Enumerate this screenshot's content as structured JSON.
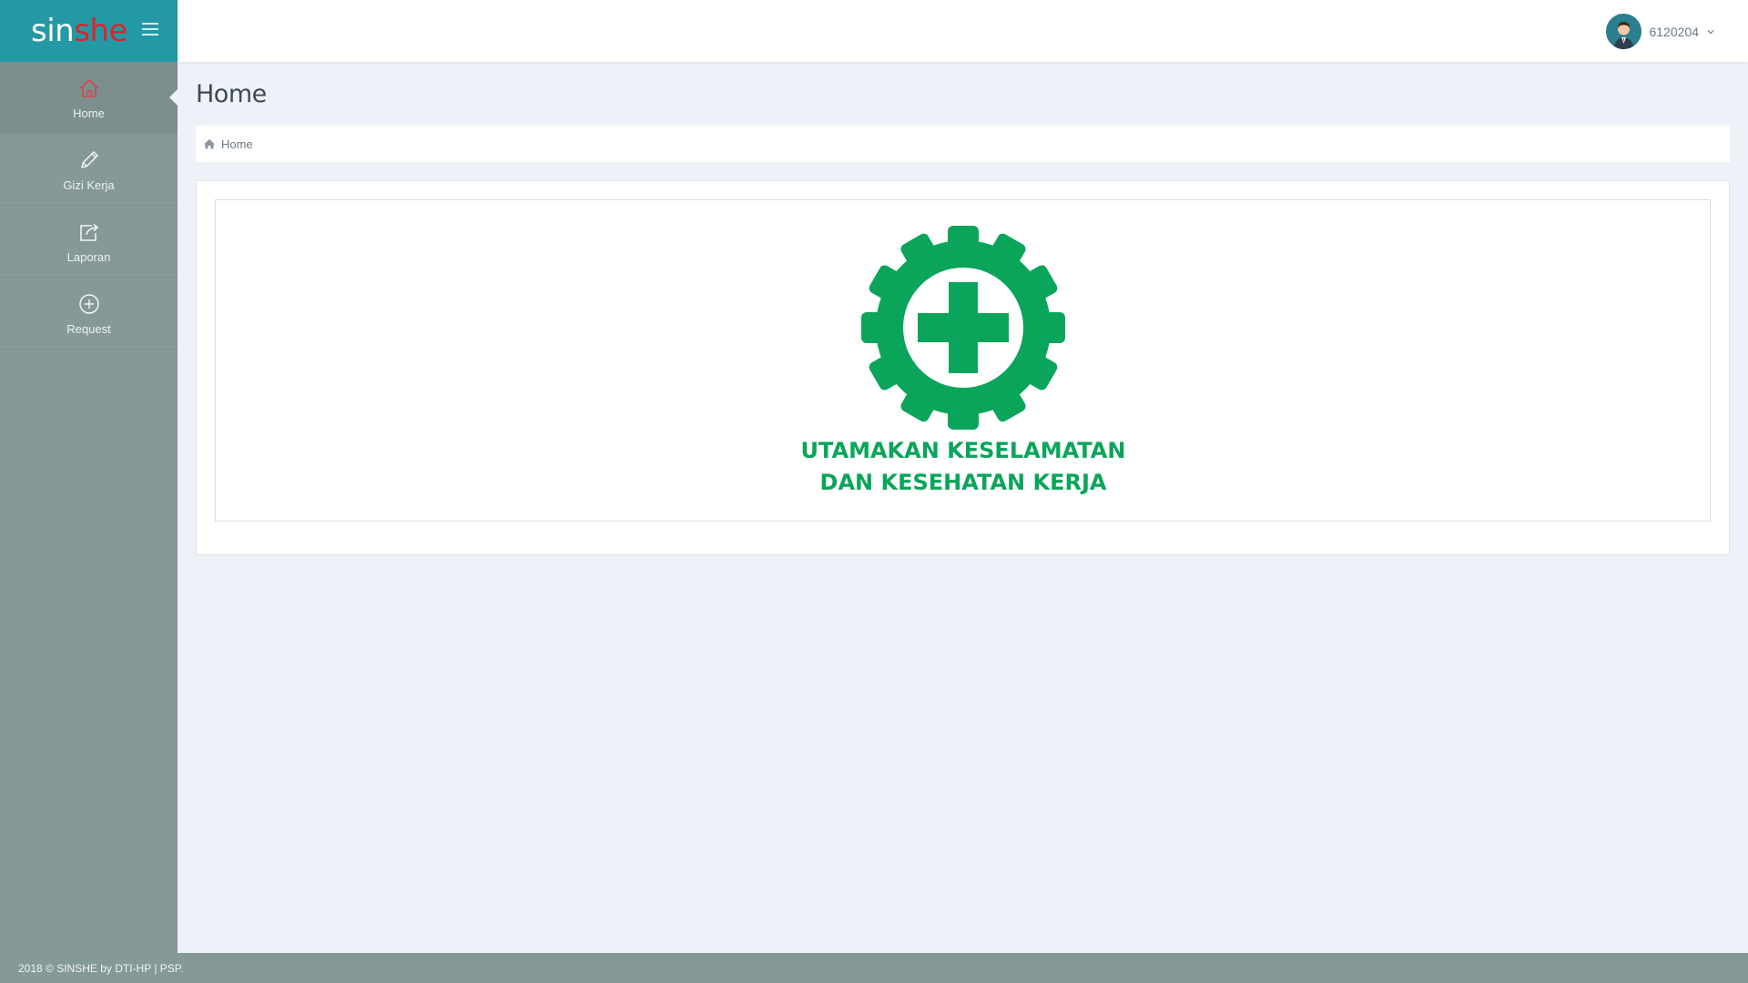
{
  "brand": {
    "part1": "sin",
    "part2": "she"
  },
  "header": {
    "username": "6120204"
  },
  "sidebar": {
    "items": [
      {
        "label": "Home",
        "icon": "home-icon",
        "active": true
      },
      {
        "label": "Gizi Kerja",
        "icon": "pencil-icon",
        "active": false
      },
      {
        "label": "Laporan",
        "icon": "share-icon",
        "active": false
      },
      {
        "label": "Request",
        "icon": "plus-circle-icon",
        "active": false
      }
    ]
  },
  "page": {
    "title": "Home"
  },
  "breadcrumb": {
    "items": [
      "Home"
    ]
  },
  "logo": {
    "line1": "UTAMAKAN KESELAMATAN",
    "line2": "DAN KESEHATAN KERJA",
    "color": "#0aa55a"
  },
  "footer": {
    "text": "2018 © SINSHE by DTI-HP | PSP."
  },
  "colors": {
    "brand_bg": "#2499a6",
    "brand_accent": "#d9262c",
    "sidebar_bg": "#859996",
    "content_bg": "#eef2f8"
  }
}
